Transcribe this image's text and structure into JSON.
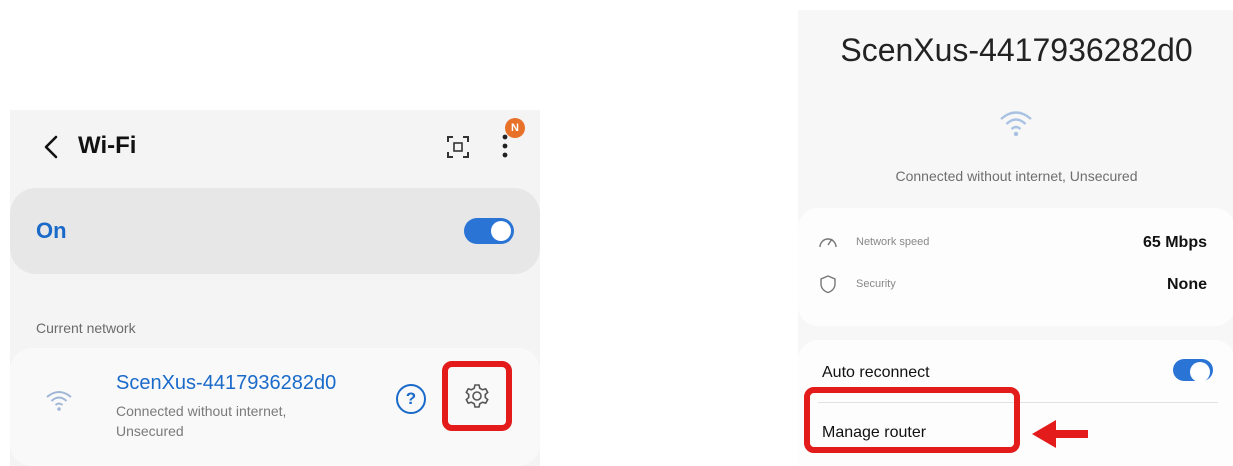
{
  "left": {
    "title": "Wi-Fi",
    "badge": "N",
    "toggle_label": "On",
    "section_label": "Current network",
    "network": {
      "name": "ScenXus-4417936282d0",
      "status": "Connected without internet, Unsecured"
    },
    "help_glyph": "?",
    "icons": [
      "back-arrow-icon",
      "qr-scan-icon",
      "more-options-icon",
      "wifi-icon",
      "help-icon",
      "gear-icon"
    ]
  },
  "right": {
    "title": "ScenXus-4417936282d0",
    "status": "Connected without internet, Unsecured",
    "info": [
      {
        "label": "Network speed",
        "value": "65 Mbps",
        "icon": "speedometer-icon"
      },
      {
        "label": "Security",
        "value": "None",
        "icon": "shield-icon"
      }
    ],
    "auto_reconnect_label": "Auto reconnect",
    "manage_router_label": "Manage router"
  },
  "colors": {
    "accent": "#1a6ac9",
    "toggle": "#2a74d6",
    "highlight": "#e31b1b",
    "badge": "#e8712a"
  },
  "toggles": {
    "wifi_on": true,
    "auto_reconnect": true
  }
}
